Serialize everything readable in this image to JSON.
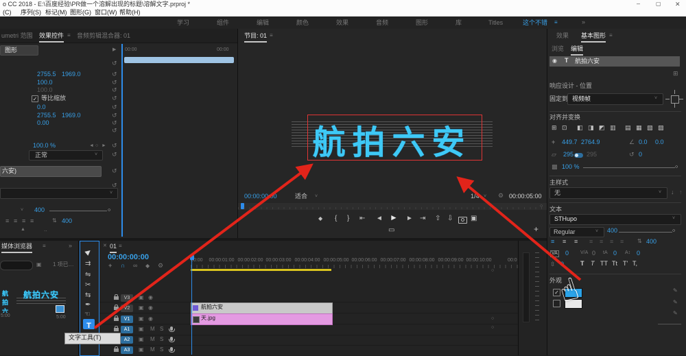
{
  "title_bar": {
    "title": "o CC 2018 - E:\\百度经验\\PR做一个溶解出现的标题\\溶解文字.prproj *"
  },
  "menu_bar": {
    "items": [
      "(C)",
      "序列(S)",
      "标记(M)",
      "图形(G)",
      "窗口(W)",
      "帮助(H)"
    ]
  },
  "workspace": {
    "tabs": [
      "学习",
      "组件",
      "编辑",
      "颜色",
      "效果",
      "音频",
      "图形",
      "库",
      "Titles",
      "这个不错"
    ]
  },
  "effect_controls": {
    "tab_lumetri": "umetri 范围",
    "tab_main": "效果控件",
    "tab_mixer": "音频剪辑混合器: 01",
    "clip_name": "图形",
    "ruler_start": "00:00",
    "ruler_end": "00:00",
    "position": {
      "x": "2755.5",
      "y": "1969.0"
    },
    "scale": "100.0",
    "scale_width": "100.0",
    "uniform_scale_label": "等比缩放",
    "rotation": "0.0",
    "anchor": {
      "x": "2755.5",
      "y": "1969.0"
    },
    "antiflicker": "0.00",
    "opacity": "100.0 %",
    "blend_mode": "正常",
    "text_element": "六安)",
    "font_size": "400",
    "leading": "400"
  },
  "program": {
    "tab": "节目: 01",
    "timecode": "00:00:00:00",
    "fit": "适合",
    "zoom_level": "1/4",
    "duration": "00:00:05:00",
    "overlay_text": "航拍六安"
  },
  "essential_graphics": {
    "tab_effects": "效果",
    "tab_title": "基本图形",
    "tab_browse": "浏览",
    "tab_edit": "编辑",
    "layer_text": "航拍六安",
    "responsive_label": "响应设计 - 位置",
    "pin_label": "固定到",
    "pin_value": "视频帧",
    "align_header": "对齐并变换",
    "position": {
      "x": "449.7",
      "y": "2764.9"
    },
    "anchor": {
      "x": "0.0",
      "y": "0.0"
    },
    "scale": "295",
    "scale_linked": "295",
    "rotation": "0",
    "opacity": "100 %",
    "master_label": "主样式",
    "master_value": "无",
    "text_header": "文本",
    "font_family": "STHupo",
    "font_style": "Regular",
    "font_size": "400",
    "leading": "400",
    "tracking": "0",
    "kerning": "0",
    "tsume": "0",
    "baseline_dist": "0",
    "baseline_shift": "0",
    "caps": [
      "T",
      "T",
      "TT",
      "Tt",
      "T'",
      "T,"
    ],
    "appearance_header": "外观"
  },
  "media_browser": {
    "tab": "媒体浏览器",
    "status": "1 项已…",
    "thumb_text": "航拍六安",
    "duration": "5:00",
    "duration_left": "5:00"
  },
  "tools": {
    "tooltip": "文字工具(T)"
  },
  "timeline": {
    "tab": "01",
    "timecode": "00:00:00:00",
    "ruler": [
      "00:00",
      "00:00:01:00",
      "00:00:02:00",
      "00:00:03:00",
      "00:00:04:00",
      "00:00:05:00",
      "00:00:06:00",
      "00:00:07:00",
      "00:00:08:00",
      "00:00:09:00",
      "00:00:10:00"
    ],
    "ruler_partial": "00:0",
    "video_tracks": [
      "V3",
      "V2",
      "V1"
    ],
    "audio_tracks": [
      "A1",
      "A2",
      "A3"
    ],
    "mute": "M",
    "solo": "S",
    "clips": [
      {
        "label": "航拍六安"
      },
      {
        "label": "天.jpg"
      }
    ]
  },
  "colors": {
    "accent": "#38a0e8",
    "overlay_text": "#3ec9f6",
    "clip_pink": "#e49ae2",
    "work_bar": "#d9c41f",
    "arrow": "#e2241a",
    "fill_swatch": "#2ba3e8"
  },
  "icons": {
    "minimize": "–",
    "maximize": "▢",
    "close": "✕",
    "menu": "≡",
    "overflow": "»",
    "dropdown": "˅",
    "expander": "▶",
    "reset": "↺",
    "check": "✓",
    "eye": "◉",
    "kf_prev": "◄",
    "kf_add": "○",
    "kf_next": "►",
    "marker": "◆",
    "mark_in": "{",
    "mark_out": "}",
    "go_in": "⇤",
    "step_back": "◄",
    "play": "►",
    "step_fwd": "►",
    "go_out": "⇥",
    "lift": "⇧",
    "extract": "⇩",
    "compare": "▣",
    "pip": "▭",
    "plus": "+",
    "settings": "⚙",
    "nest": "+",
    "snap": "∩",
    "link": "∞",
    "tool_select": "▶",
    "tool_track": "⇉",
    "tool_ripple": "⇋",
    "tool_razor": "✂",
    "tool_slip": "⇆",
    "tool_pen": "✒",
    "tool_hand": "☜",
    "tool_type": "T",
    "target": "▣",
    "view": "▣",
    "new_layer": "⊞",
    "align_1": "⊞",
    "align_2": "⊡",
    "align_3": "◧",
    "align_4": "◨",
    "align_5": "◩",
    "align_6": "▥",
    "align_7": "▤",
    "align_8": "▦",
    "align_9": "▧",
    "align_10": "▨",
    "pos": "+",
    "anchor": "∠",
    "scale": "▱",
    "rotate": "↺",
    "opacity": "▩",
    "down": "↓",
    "up": "↑",
    "align_text": "≡",
    "leading": "⇅",
    "tracking": "VA",
    "kerning": "V/A",
    "tsume": "tA",
    "baseline_dist": "A↕",
    "baseline_shift": "⇳",
    "eyedropper": "✎",
    "hand_cursor": "☝",
    "scroll_dot": "○",
    "up_small": "▲",
    "dots": "‥"
  }
}
